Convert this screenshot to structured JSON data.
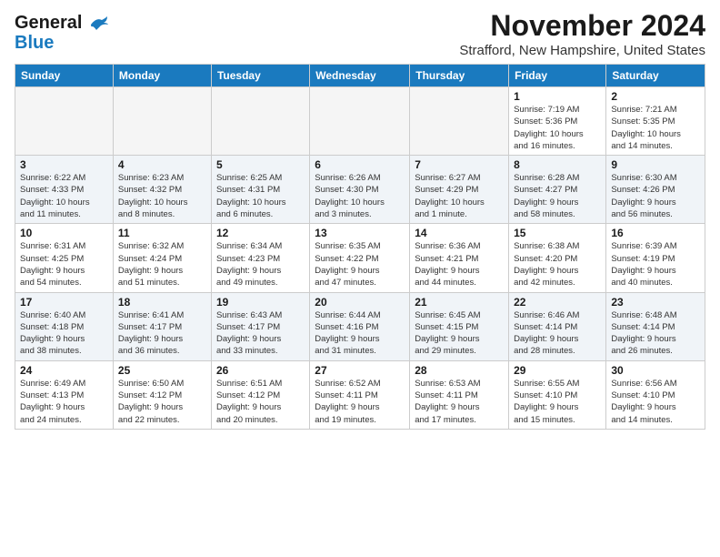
{
  "logo": {
    "line1": "General",
    "line2": "Blue"
  },
  "title": "November 2024",
  "location": "Strafford, New Hampshire, United States",
  "weekdays": [
    "Sunday",
    "Monday",
    "Tuesday",
    "Wednesday",
    "Thursday",
    "Friday",
    "Saturday"
  ],
  "weeks": [
    [
      {
        "day": "",
        "info": ""
      },
      {
        "day": "",
        "info": ""
      },
      {
        "day": "",
        "info": ""
      },
      {
        "day": "",
        "info": ""
      },
      {
        "day": "",
        "info": ""
      },
      {
        "day": "1",
        "info": "Sunrise: 7:19 AM\nSunset: 5:36 PM\nDaylight: 10 hours\nand 16 minutes."
      },
      {
        "day": "2",
        "info": "Sunrise: 7:21 AM\nSunset: 5:35 PM\nDaylight: 10 hours\nand 14 minutes."
      }
    ],
    [
      {
        "day": "3",
        "info": "Sunrise: 6:22 AM\nSunset: 4:33 PM\nDaylight: 10 hours\nand 11 minutes."
      },
      {
        "day": "4",
        "info": "Sunrise: 6:23 AM\nSunset: 4:32 PM\nDaylight: 10 hours\nand 8 minutes."
      },
      {
        "day": "5",
        "info": "Sunrise: 6:25 AM\nSunset: 4:31 PM\nDaylight: 10 hours\nand 6 minutes."
      },
      {
        "day": "6",
        "info": "Sunrise: 6:26 AM\nSunset: 4:30 PM\nDaylight: 10 hours\nand 3 minutes."
      },
      {
        "day": "7",
        "info": "Sunrise: 6:27 AM\nSunset: 4:29 PM\nDaylight: 10 hours\nand 1 minute."
      },
      {
        "day": "8",
        "info": "Sunrise: 6:28 AM\nSunset: 4:27 PM\nDaylight: 9 hours\nand 58 minutes."
      },
      {
        "day": "9",
        "info": "Sunrise: 6:30 AM\nSunset: 4:26 PM\nDaylight: 9 hours\nand 56 minutes."
      }
    ],
    [
      {
        "day": "10",
        "info": "Sunrise: 6:31 AM\nSunset: 4:25 PM\nDaylight: 9 hours\nand 54 minutes."
      },
      {
        "day": "11",
        "info": "Sunrise: 6:32 AM\nSunset: 4:24 PM\nDaylight: 9 hours\nand 51 minutes."
      },
      {
        "day": "12",
        "info": "Sunrise: 6:34 AM\nSunset: 4:23 PM\nDaylight: 9 hours\nand 49 minutes."
      },
      {
        "day": "13",
        "info": "Sunrise: 6:35 AM\nSunset: 4:22 PM\nDaylight: 9 hours\nand 47 minutes."
      },
      {
        "day": "14",
        "info": "Sunrise: 6:36 AM\nSunset: 4:21 PM\nDaylight: 9 hours\nand 44 minutes."
      },
      {
        "day": "15",
        "info": "Sunrise: 6:38 AM\nSunset: 4:20 PM\nDaylight: 9 hours\nand 42 minutes."
      },
      {
        "day": "16",
        "info": "Sunrise: 6:39 AM\nSunset: 4:19 PM\nDaylight: 9 hours\nand 40 minutes."
      }
    ],
    [
      {
        "day": "17",
        "info": "Sunrise: 6:40 AM\nSunset: 4:18 PM\nDaylight: 9 hours\nand 38 minutes."
      },
      {
        "day": "18",
        "info": "Sunrise: 6:41 AM\nSunset: 4:17 PM\nDaylight: 9 hours\nand 36 minutes."
      },
      {
        "day": "19",
        "info": "Sunrise: 6:43 AM\nSunset: 4:17 PM\nDaylight: 9 hours\nand 33 minutes."
      },
      {
        "day": "20",
        "info": "Sunrise: 6:44 AM\nSunset: 4:16 PM\nDaylight: 9 hours\nand 31 minutes."
      },
      {
        "day": "21",
        "info": "Sunrise: 6:45 AM\nSunset: 4:15 PM\nDaylight: 9 hours\nand 29 minutes."
      },
      {
        "day": "22",
        "info": "Sunrise: 6:46 AM\nSunset: 4:14 PM\nDaylight: 9 hours\nand 28 minutes."
      },
      {
        "day": "23",
        "info": "Sunrise: 6:48 AM\nSunset: 4:14 PM\nDaylight: 9 hours\nand 26 minutes."
      }
    ],
    [
      {
        "day": "24",
        "info": "Sunrise: 6:49 AM\nSunset: 4:13 PM\nDaylight: 9 hours\nand 24 minutes."
      },
      {
        "day": "25",
        "info": "Sunrise: 6:50 AM\nSunset: 4:12 PM\nDaylight: 9 hours\nand 22 minutes."
      },
      {
        "day": "26",
        "info": "Sunrise: 6:51 AM\nSunset: 4:12 PM\nDaylight: 9 hours\nand 20 minutes."
      },
      {
        "day": "27",
        "info": "Sunrise: 6:52 AM\nSunset: 4:11 PM\nDaylight: 9 hours\nand 19 minutes."
      },
      {
        "day": "28",
        "info": "Sunrise: 6:53 AM\nSunset: 4:11 PM\nDaylight: 9 hours\nand 17 minutes."
      },
      {
        "day": "29",
        "info": "Sunrise: 6:55 AM\nSunset: 4:10 PM\nDaylight: 9 hours\nand 15 minutes."
      },
      {
        "day": "30",
        "info": "Sunrise: 6:56 AM\nSunset: 4:10 PM\nDaylight: 9 hours\nand 14 minutes."
      }
    ]
  ]
}
